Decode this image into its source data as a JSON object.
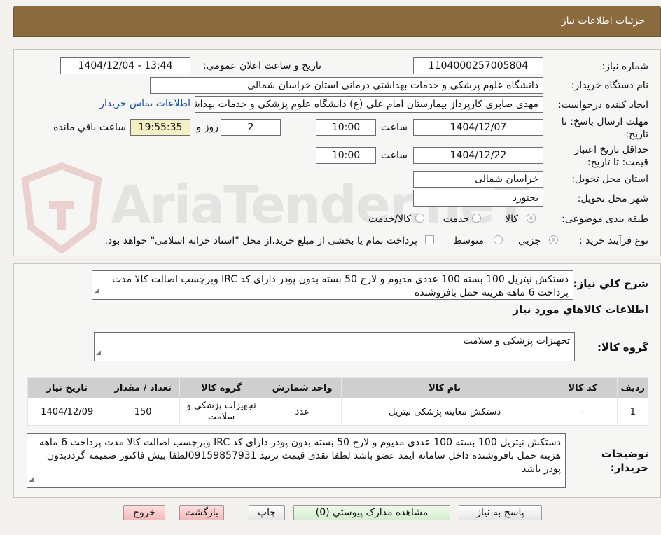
{
  "header": {
    "title": "جزئیات اطلاعات نیاز"
  },
  "watermark": "AriaTender.neT",
  "form": {
    "need_number_label": "شماره نیاز:",
    "need_number": "1104000257005804",
    "announce_label": "تاریخ و ساعت اعلان عمومي:",
    "announce_value": "1404/12/04 - 13:44",
    "buyer_org_label": "نام دستگاه خریدار:",
    "buyer_org": "دانشگاه علوم پزشکی و خدمات بهداشتی درمانی استان خراسان شمالی",
    "creator_label": "ایجاد کننده درخواست:",
    "creator": "مهدی صابری کارپرداز بیمارستان امام علی (ع) دانشگاه علوم پزشکی و خدمات بهداشتی",
    "contact_link": "اطلاعات تماس خریدار",
    "deadline_label": "مهلت ارسال پاسخ: تا تاریخ:",
    "deadline_date": "1404/12/07",
    "time_label": "ساعت",
    "deadline_time": "10:00",
    "days_value": "2",
    "days_label": "روز و",
    "remaining_time": "19:55:35",
    "remaining_label": "ساعت باقي مانده",
    "validity_label": "حداقل تاریخ اعتبار قیمت: تا تاریخ:",
    "validity_date": "1404/12/22",
    "validity_time": "10:00",
    "province_label": "استان محل تحویل:",
    "province": "خراسان شمالی",
    "city_label": "شهر محل تحویل:",
    "city": "بجنورد",
    "category_label": "طبقه بندی موضوعی:",
    "category_options": [
      "کالا",
      "خدمت",
      "کالا/خدمت"
    ],
    "category_selected": "کالا",
    "process_label": "نوع فرآیند خرید :",
    "process_options": [
      "جزیي",
      "متوسط"
    ],
    "process_selected": "جزیي",
    "treasury_note": "پرداخت تمام یا بخشی از مبلغ خرید،از محل \"اسناد خزانه اسلامی\" خواهد بود."
  },
  "summary": {
    "label": "شرح کلي نیاز:",
    "text": "دستکش نیتریل 100 بسته 100 عددی مدیوم و لارج 50 بسته بدون پودر  دارای کد IRC وبرچسب اصالت کالا مدت پرداخت 6 ماهه هزینه حمل بافروشنده",
    "goods_info_title": "اطلاعات کالاهاي مورد نياز",
    "goods_group_label": "گروه کالا:",
    "goods_group": "تجهیزات پزشکی و سلامت"
  },
  "table": {
    "headers": [
      "ردیف",
      "کد کالا",
      "نام کالا",
      "واحد شمارش",
      "گروه کالا",
      "تعداد / مقدار",
      "تاریخ نیاز"
    ],
    "rows": [
      [
        "1",
        "--",
        "دستکش معاینه پزشکی نیتریل",
        "عدد",
        "تجهیزات پزشکی و سلامت",
        "150",
        "1404/12/09"
      ]
    ]
  },
  "buyer_notes": {
    "label": "توضیحات خریدار:",
    "text": "دستکش نیتریل 100 بسته 100 عددی مدیوم و لارج 50 بسته بدون پودر  دارای کد IRC وبرچسب اصالت کالا مدت پرداخت 6 ماهه هزینه حمل بافروشنده داخل سامانه ایمد عضو باشد لطفا نقدی قیمت نزنید 09159857931لطفا پیش فاکتور ضمیمه گرددبدون پودر باشد"
  },
  "buttons": {
    "reply": "پاسخ به نیاز",
    "attachments": "مشاهده مدارک پیوستي (0)",
    "print": "چاپ",
    "back": "بازگشت",
    "exit": "خروج"
  }
}
